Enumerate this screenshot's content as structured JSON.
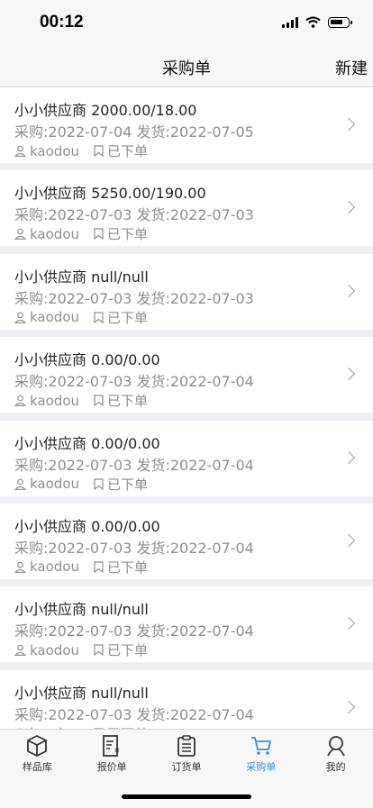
{
  "status": {
    "time": "00:12"
  },
  "nav": {
    "title": "采购单",
    "new_label": "新建"
  },
  "orders": [
    {
      "title": "小小供应商 2000.00/18.00",
      "dates": "采购:2022-07-04 发货:2022-07-05",
      "user": "kaodou",
      "status": "已下单"
    },
    {
      "title": "小小供应商 5250.00/190.00",
      "dates": "采购:2022-07-03 发货:2022-07-03",
      "user": "kaodou",
      "status": "已下单"
    },
    {
      "title": "小小供应商 null/null",
      "dates": "采购:2022-07-03 发货:2022-07-03",
      "user": "kaodou",
      "status": "已下单"
    },
    {
      "title": "小小供应商 0.00/0.00",
      "dates": "采购:2022-07-03 发货:2022-07-04",
      "user": "kaodou",
      "status": "已下单"
    },
    {
      "title": "小小供应商 0.00/0.00",
      "dates": "采购:2022-07-03 发货:2022-07-04",
      "user": "kaodou",
      "status": "已下单"
    },
    {
      "title": "小小供应商 0.00/0.00",
      "dates": "采购:2022-07-03 发货:2022-07-04",
      "user": "kaodou",
      "status": "已下单"
    },
    {
      "title": "小小供应商 null/null",
      "dates": "采购:2022-07-03 发货:2022-07-04",
      "user": "kaodou",
      "status": "已下单"
    },
    {
      "title": "小小供应商 null/null",
      "dates": "采购:2022-07-03 发货:2022-07-04",
      "user": "kaodou",
      "status": "已下单"
    }
  ],
  "tabs": [
    {
      "label": "样品库",
      "icon": "box-icon"
    },
    {
      "label": "报价单",
      "icon": "quote-doc-icon"
    },
    {
      "label": "订货单",
      "icon": "clipboard-icon"
    },
    {
      "label": "采购单",
      "icon": "cart-icon",
      "active": true
    },
    {
      "label": "我的",
      "icon": "profile-icon"
    }
  ],
  "colors": {
    "accent": "#3b8ed4",
    "background": "#efeff4"
  }
}
